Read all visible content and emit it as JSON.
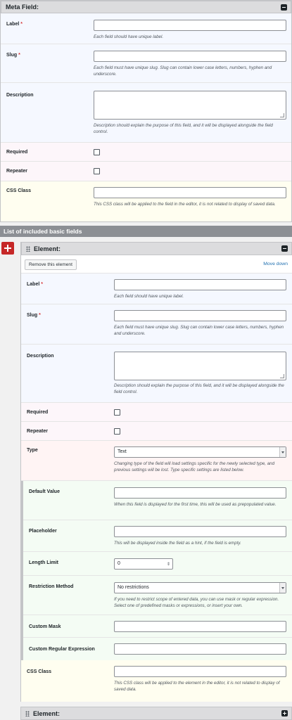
{
  "meta": {
    "header": "Meta Field:",
    "label": {
      "text": "Label",
      "req": "*",
      "hint": "Each field should have unique label."
    },
    "slug": {
      "text": "Slug",
      "req": "*",
      "hint": "Each field must have unique slug. Slug can contain lower case letters, numbers, hyphen and underscore."
    },
    "description": {
      "text": "Description",
      "hint": "Description should explain the purpose of this field, and it will be displayed alongside the field control."
    },
    "required": {
      "text": "Required"
    },
    "repeater": {
      "text": "Repeater"
    },
    "css": {
      "text": "CSS Class",
      "hint": "This CSS class will be applied to the field in the editor, it is not related to display of saved data."
    }
  },
  "section_title": "List of included basic fields",
  "element": {
    "header": "Element:",
    "remove_label": "Remove this element",
    "move_down_label": "Move down",
    "label": {
      "text": "Label",
      "req": "*",
      "hint": "Each field should have unique label."
    },
    "slug": {
      "text": "Slug",
      "req": "*",
      "hint": "Each field must have unique slug. Slug can contain lower case letters, numbers, hyphen and underscore."
    },
    "description": {
      "text": "Description",
      "hint": "Description should explain the purpose of this field, and it will be displayed alongside the field control."
    },
    "required": {
      "text": "Required"
    },
    "repeater": {
      "text": "Repeater"
    },
    "type": {
      "text": "Type",
      "value": "Text",
      "hint": "Changing type of the field will load settings specific for the newly selected type, and previous settings will be lost. Type specific settings are listed below."
    },
    "default_value": {
      "text": "Default Value",
      "hint": "When this field is displayed for the first time, this will be used as prepopulated value."
    },
    "placeholder": {
      "text": "Placeholder",
      "hint": "This will be displayed inside the field as a hint, if the field is empty."
    },
    "length_limit": {
      "text": "Length Limit",
      "value": "0"
    },
    "restriction": {
      "text": "Restriction Method",
      "value": "No restrictions",
      "hint": "If you need to restrict scope of entered data, you can use mask or regular expression. Select one of predefined masks or expressions, or insert your own."
    },
    "custom_mask": {
      "text": "Custom Mask"
    },
    "custom_regex": {
      "text": "Custom Regular Expression"
    },
    "css": {
      "text": "CSS Class",
      "hint": "This CSS class will be applied to the element in the editor, it is not related to display of saved data."
    }
  },
  "element2": {
    "header": "Element:"
  }
}
